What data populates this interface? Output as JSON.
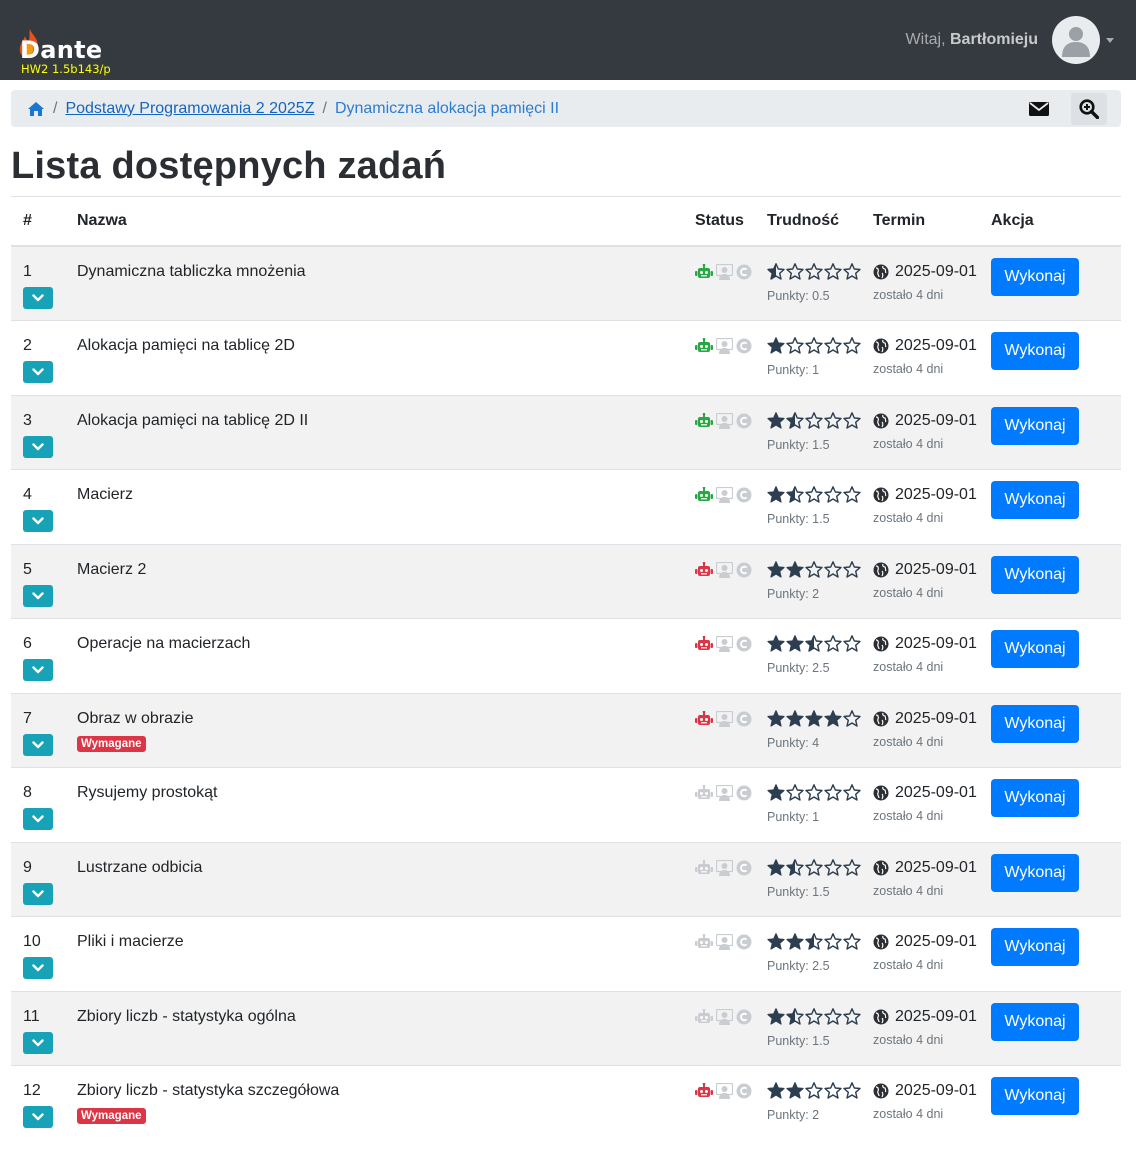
{
  "navbar": {
    "brand": "Dante",
    "version": "HW2 1.5b143/p",
    "greeting": "Witaj,",
    "user_name": "Bartłomieju"
  },
  "breadcrumb": {
    "course": "Podstawy Programowania 2 2025Z",
    "current": "Dynamiczna alokacja pamięci II"
  },
  "page_title": "Lista dostępnych zadań",
  "table": {
    "headers": {
      "num": "#",
      "name": "Nazwa",
      "status": "Status",
      "difficulty": "Trudność",
      "deadline": "Termin",
      "action": "Akcja"
    },
    "rows": [
      {
        "num": "1",
        "name": "Dynamiczna tabliczka mnożenia",
        "robot": "green",
        "stars": 0.5,
        "points": "Punkty: 0.5",
        "date": "2025-09-01",
        "left": "zostało 4 dni",
        "action": "Wykonaj",
        "required": ""
      },
      {
        "num": "2",
        "name": "Alokacja pamięci na tablicę 2D",
        "robot": "green",
        "stars": 1,
        "points": "Punkty: 1",
        "date": "2025-09-01",
        "left": "zostało 4 dni",
        "action": "Wykonaj",
        "required": ""
      },
      {
        "num": "3",
        "name": "Alokacja pamięci na tablicę 2D II",
        "robot": "green",
        "stars": 1.5,
        "points": "Punkty: 1.5",
        "date": "2025-09-01",
        "left": "zostało 4 dni",
        "action": "Wykonaj",
        "required": ""
      },
      {
        "num": "4",
        "name": "Macierz",
        "robot": "green",
        "stars": 1.5,
        "points": "Punkty: 1.5",
        "date": "2025-09-01",
        "left": "zostało 4 dni",
        "action": "Wykonaj",
        "required": ""
      },
      {
        "num": "5",
        "name": "Macierz 2",
        "robot": "red",
        "stars": 2,
        "points": "Punkty: 2",
        "date": "2025-09-01",
        "left": "zostało 4 dni",
        "action": "Wykonaj",
        "required": ""
      },
      {
        "num": "6",
        "name": "Operacje na macierzach",
        "robot": "red",
        "stars": 2.5,
        "points": "Punkty: 2.5",
        "date": "2025-09-01",
        "left": "zostało 4 dni",
        "action": "Wykonaj",
        "required": ""
      },
      {
        "num": "7",
        "name": "Obraz w obrazie",
        "robot": "red",
        "stars": 4,
        "points": "Punkty: 4",
        "date": "2025-09-01",
        "left": "zostało 4 dni",
        "action": "Wykonaj",
        "required": "Wymagane"
      },
      {
        "num": "8",
        "name": "Rysujemy prostokąt",
        "robot": "gray",
        "stars": 1,
        "points": "Punkty: 1",
        "date": "2025-09-01",
        "left": "zostało 4 dni",
        "action": "Wykonaj",
        "required": ""
      },
      {
        "num": "9",
        "name": "Lustrzane odbicia",
        "robot": "gray",
        "stars": 1.5,
        "points": "Punkty: 1.5",
        "date": "2025-09-01",
        "left": "zostało 4 dni",
        "action": "Wykonaj",
        "required": ""
      },
      {
        "num": "10",
        "name": "Pliki i macierze",
        "robot": "gray",
        "stars": 2.5,
        "points": "Punkty: 2.5",
        "date": "2025-09-01",
        "left": "zostało 4 dni",
        "action": "Wykonaj",
        "required": ""
      },
      {
        "num": "11",
        "name": "Zbiory liczb - statystyka ogólna",
        "robot": "gray",
        "stars": 1.5,
        "points": "Punkty: 1.5",
        "date": "2025-09-01",
        "left": "zostało 4 dni",
        "action": "Wykonaj",
        "required": ""
      },
      {
        "num": "12",
        "name": "Zbiory liczb - statystyka szczegółowa",
        "robot": "red",
        "stars": 2,
        "points": "Punkty: 2",
        "date": "2025-09-01",
        "left": "zostało 4 dni",
        "action": "Wykonaj",
        "required": "Wymagane"
      }
    ]
  },
  "colors": {
    "navbar": "#343a40",
    "primary": "#007bff",
    "toggle": "#17a2b8",
    "danger": "#dc3545",
    "robot_green": "#28a745",
    "robot_red": "#dc3545",
    "robot_gray": "#c9cdd1",
    "stars": "#2c3e50"
  },
  "icons": {
    "brand": "flame-icon",
    "avatar": "user-avatar-icon",
    "home": "home-icon",
    "mail": "envelope-icon",
    "zoom": "zoom-in-icon",
    "toggle": "chevron-down-icon",
    "robot": "robot-icon",
    "teacher": "teacher-icon",
    "copyright": "copyright-icon",
    "globe": "globe-icon",
    "star": "star-icon"
  }
}
